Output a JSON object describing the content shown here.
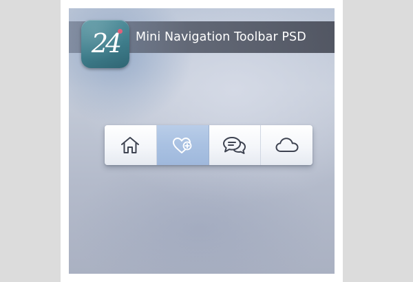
{
  "header": {
    "title": "Mini Navigation Toolbar PSD",
    "logo_text": "24"
  },
  "toolbar": {
    "active_index": 1,
    "items": [
      {
        "icon": "home-icon"
      },
      {
        "icon": "heart-plus-icon"
      },
      {
        "icon": "chat-bubbles-icon"
      },
      {
        "icon": "cloud-icon"
      }
    ]
  },
  "colors": {
    "accent": "#a9c1e2",
    "icon_stroke": "#3d4250",
    "icon_stroke_active": "#ffffff",
    "logo": "#3f7e8c"
  }
}
